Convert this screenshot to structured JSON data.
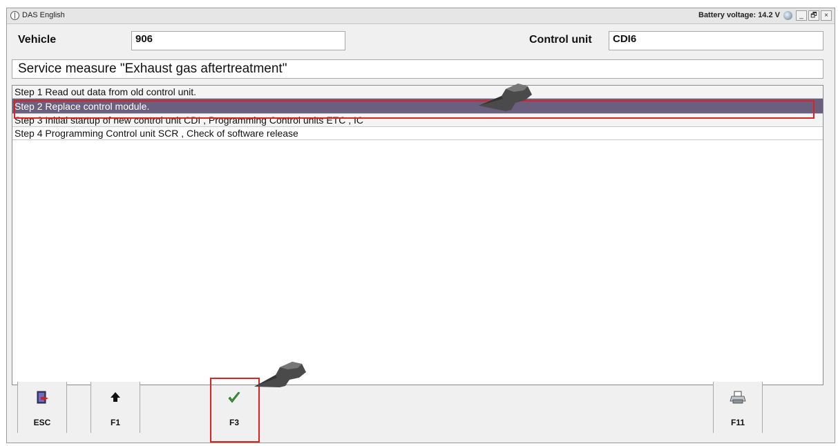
{
  "window": {
    "title": "DAS English",
    "battery": "Battery voltage: 14.2 V",
    "controls": {
      "minimize": "_",
      "maximize": "🗗",
      "close": "×"
    }
  },
  "vehicle": {
    "label": "Vehicle",
    "value": "906"
  },
  "control_unit": {
    "label": "Control unit",
    "value": "CDI6"
  },
  "heading": "Service measure \"Exhaust gas aftertreatment\"",
  "steps": [
    "Step 1 Read out data from old control unit.",
    "Step 2 Replace control module.",
    "Step 3 Initial startup of new control unit CDI , Programming Control units ETC , IC",
    "Step 4 Programming Control unit SCR , Check of software release"
  ],
  "selected_step": 1,
  "fkeys": {
    "esc": {
      "label": "ESC",
      "icon": "exit-door-icon"
    },
    "f1": {
      "label": "F1",
      "icon": "up-arrow-icon"
    },
    "f3": {
      "label": "F3",
      "icon": "checkmark-icon"
    },
    "f11": {
      "label": "F11",
      "icon": "printer-icon"
    }
  },
  "colors": {
    "selection": "#6b5f7f",
    "highlight": "#e02020",
    "check": "#2f9a2f"
  }
}
